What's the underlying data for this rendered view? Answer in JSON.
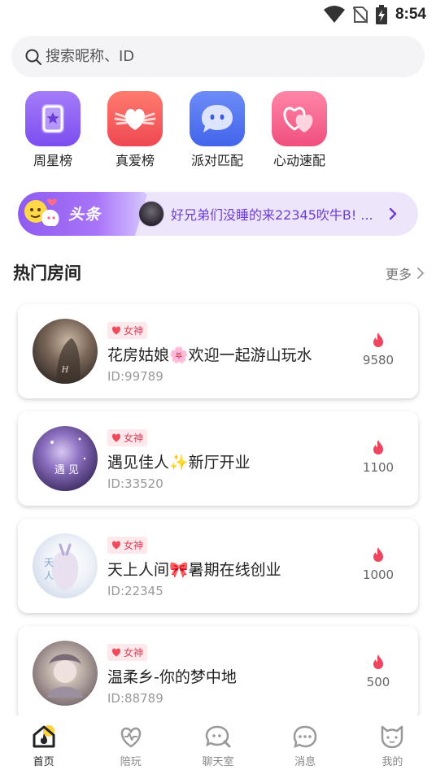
{
  "status_bar": {
    "time": "8:54"
  },
  "search": {
    "placeholder": "搜索昵称、ID"
  },
  "shortcuts": [
    {
      "label": "周星榜",
      "icon": "star-bookmark-icon",
      "color": "#8a5cf5"
    },
    {
      "label": "真爱榜",
      "icon": "winged-heart-icon",
      "color": "#f0555a"
    },
    {
      "label": "派对匹配",
      "icon": "chat-bubble-face-icon",
      "color": "#4c6ff0"
    },
    {
      "label": "心动速配",
      "icon": "double-heart-icon",
      "color": "#f05b8a"
    }
  ],
  "news": {
    "badge": "头条",
    "text": "好兄弟们没睡的来22345吹牛B! ..."
  },
  "hot_rooms": {
    "title": "热门房间",
    "more": "更多",
    "rooms": [
      {
        "badge": "女神",
        "title": "花房姑娘🌸欢迎一起游山玩水",
        "id": "ID:99789",
        "heat": "9580"
      },
      {
        "badge": "女神",
        "title": "遇见佳人✨新厅开业",
        "id": "ID:33520",
        "heat": "1100"
      },
      {
        "badge": "女神",
        "title": "天上人间🎀暑期在线创业",
        "id": "ID:22345",
        "heat": "1000"
      },
      {
        "badge": "女神",
        "title": "温柔乡-你的梦中地",
        "id": "ID:88789",
        "heat": "500"
      }
    ]
  },
  "bottom_nav": [
    {
      "label": "首页",
      "icon": "home-flame-icon",
      "active": true
    },
    {
      "label": "陪玩",
      "icon": "heart-pulse-icon",
      "active": false
    },
    {
      "label": "聊天室",
      "icon": "chat-search-icon",
      "active": false
    },
    {
      "label": "消息",
      "icon": "message-dots-icon",
      "active": false
    },
    {
      "label": "我的",
      "icon": "cat-face-icon",
      "active": false
    }
  ],
  "colors": {
    "accent_purple": "#6e3dd9",
    "badge_red": "#e0405a",
    "flame_red": "#f0455e"
  }
}
